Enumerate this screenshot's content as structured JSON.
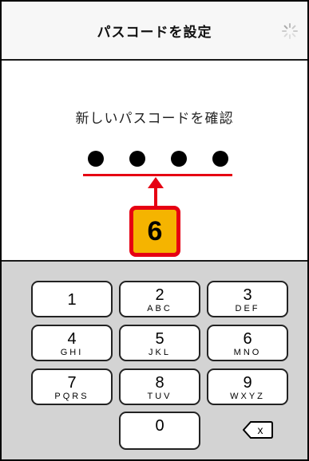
{
  "header": {
    "title": "パスコードを設定",
    "spinner_icon": "activity-spinner-icon"
  },
  "main": {
    "prompt": "新しいパスコードを確認",
    "entered_digits": 4,
    "total_digits": 4
  },
  "callout": {
    "step_number": "6",
    "color": "#f5b400",
    "border_color": "#e60012"
  },
  "keypad": {
    "keys": [
      {
        "digit": "1",
        "letters": ""
      },
      {
        "digit": "2",
        "letters": "ABC"
      },
      {
        "digit": "3",
        "letters": "DEF"
      },
      {
        "digit": "4",
        "letters": "GHI"
      },
      {
        "digit": "5",
        "letters": "JKL"
      },
      {
        "digit": "6",
        "letters": "MNO"
      },
      {
        "digit": "7",
        "letters": "PQRS"
      },
      {
        "digit": "8",
        "letters": "TUV"
      },
      {
        "digit": "9",
        "letters": "WXYZ"
      },
      {
        "digit": "0",
        "letters": ""
      }
    ],
    "delete_label": "x",
    "delete_icon": "backspace-icon"
  }
}
